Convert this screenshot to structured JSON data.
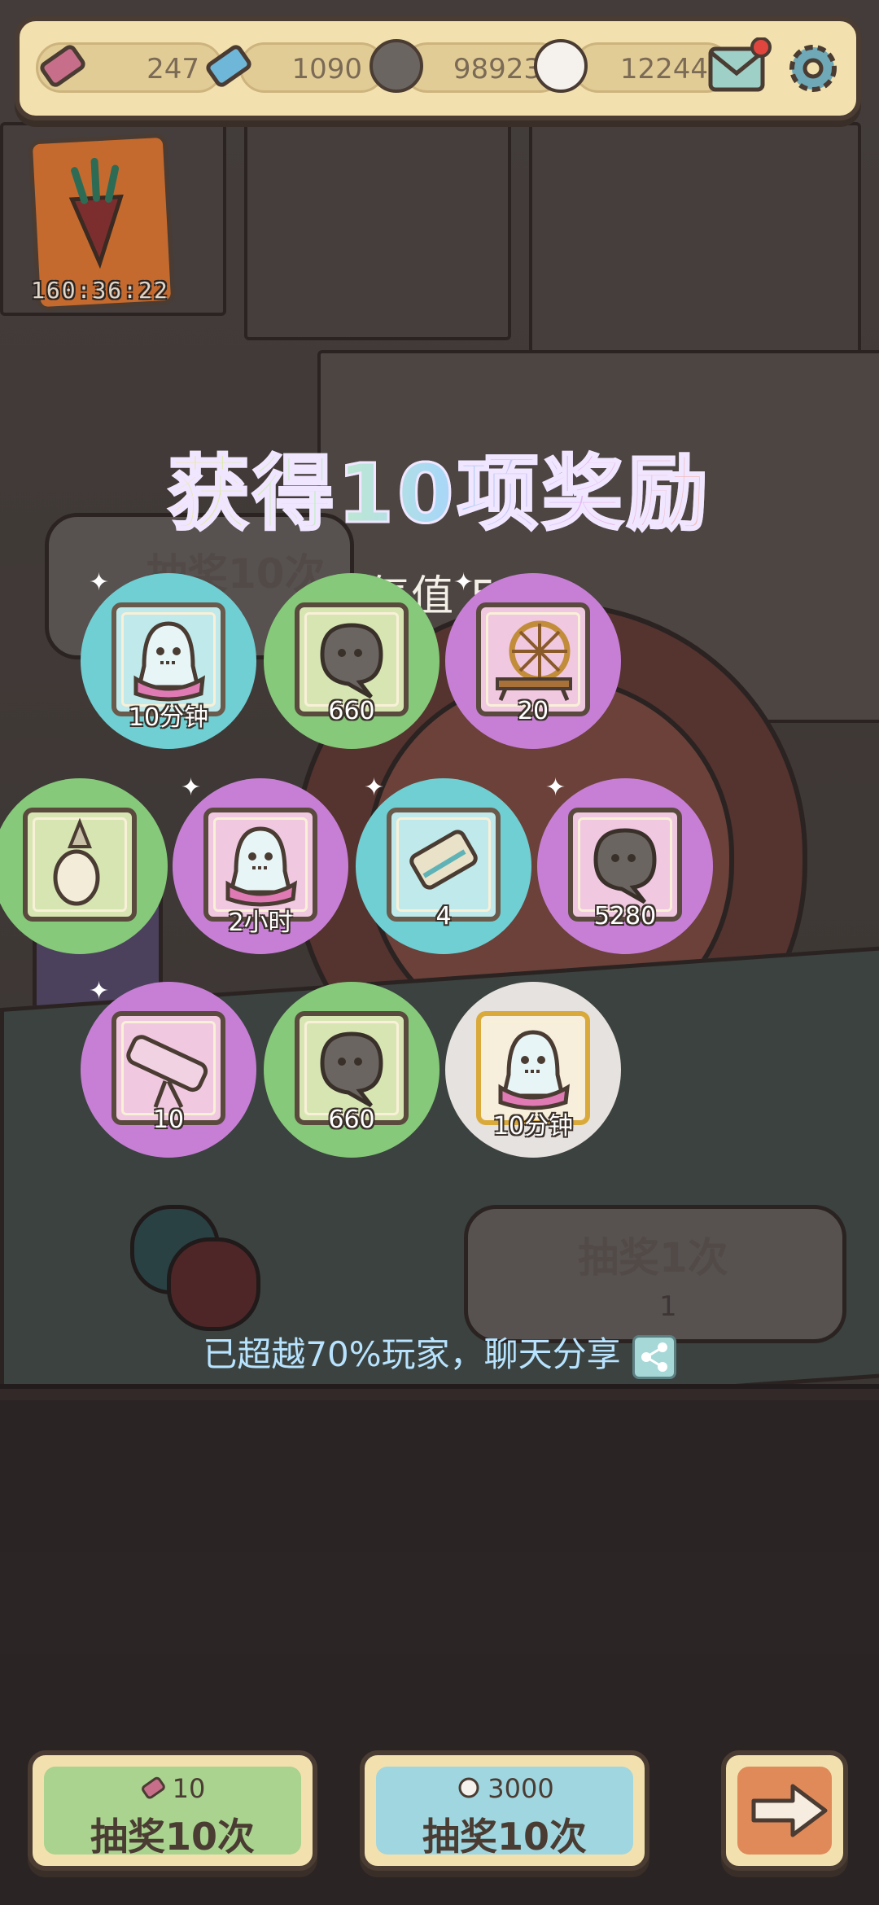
{
  "topbar": {
    "tickets_pink": "247",
    "tickets_blue": "1090",
    "ghost_dark": "98923",
    "ghost_white": "12244"
  },
  "event": {
    "timer": "160:36:22"
  },
  "background": {
    "draw10_label": "抽奖10次",
    "draw10_cost": "10",
    "draw1_label": "抽奖1次",
    "draw1_cost": "1"
  },
  "result": {
    "title": "获得10项奖励",
    "luck_label": "欧气值 526",
    "share_text": "已超越70%玩家，聊天分享"
  },
  "rewards": [
    {
      "icon": "ghost-dress-icon",
      "qty": "10分钟",
      "color": "cyan"
    },
    {
      "icon": "dark-ghost-icon",
      "qty": "660",
      "color": "green"
    },
    {
      "icon": "spinning-wheel-icon",
      "qty": "20",
      "color": "purple"
    },
    {
      "icon": "pearl-pendant-icon",
      "qty": "",
      "color": "green"
    },
    {
      "icon": "ghost-dress-icon",
      "qty": "2小时",
      "color": "purple"
    },
    {
      "icon": "scroll-icon",
      "qty": "4",
      "color": "cyan"
    },
    {
      "icon": "dark-ghost-icon",
      "qty": "5280",
      "color": "purple"
    },
    {
      "icon": "telescope-icon",
      "qty": "10",
      "color": "purple"
    },
    {
      "icon": "dark-ghost-icon",
      "qty": "660",
      "color": "green"
    },
    {
      "icon": "ghost-dress-icon",
      "qty": "10分钟",
      "color": "white"
    }
  ],
  "buttons": {
    "draw10_ticket_cost": "10",
    "draw10_ticket_label": "抽奖10次",
    "draw10_ghost_cost": "3000",
    "draw10_ghost_label": "抽奖10次"
  },
  "colors": {
    "cyan": "#70cfd3",
    "green": "#86c97a",
    "purple": "#c77fd6",
    "white": "#e6e2df",
    "bar": "#f2e1ae"
  }
}
